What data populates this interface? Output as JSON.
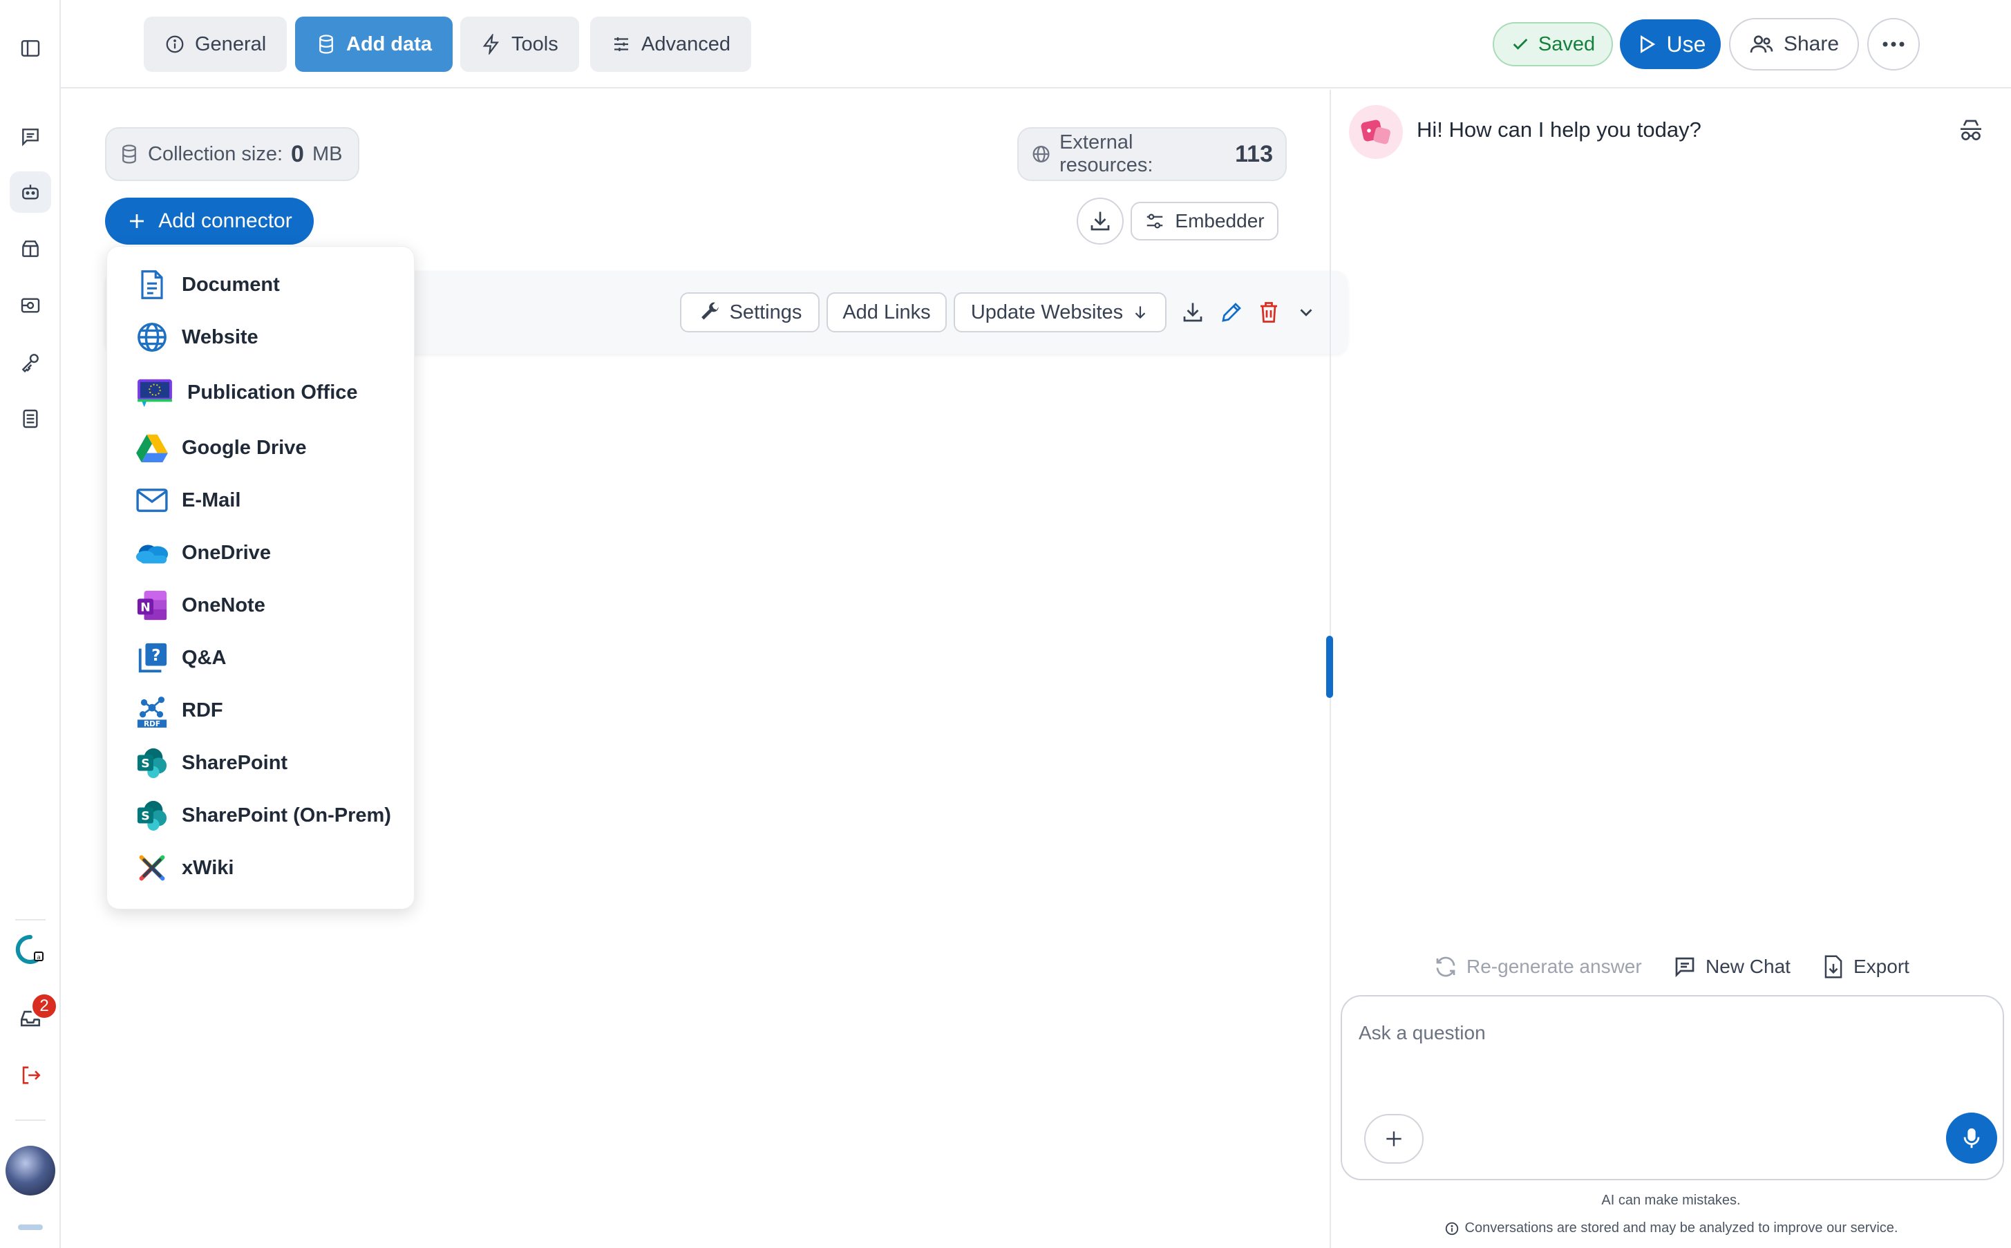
{
  "rail": {
    "notifications_count": "2"
  },
  "toolbar": {
    "tabs": [
      {
        "label": "General"
      },
      {
        "label": "Add data"
      },
      {
        "label": "Tools"
      },
      {
        "label": "Advanced"
      }
    ],
    "saved_label": "Saved",
    "use_label": "Use",
    "share_label": "Share"
  },
  "main": {
    "collection_size_label": "Collection size:",
    "collection_size_value": "0",
    "collection_size_unit": "MB",
    "external_resources_label": "External resources:",
    "external_resources_value": "113",
    "add_connector_label": "Add connector",
    "embedder_label": "Embedder",
    "card": {
      "settings_label": "Settings",
      "add_links_label": "Add Links",
      "update_websites_label": "Update Websites"
    }
  },
  "connector_menu": {
    "items": [
      {
        "label": "Document",
        "icon": "document-icon"
      },
      {
        "label": "Website",
        "icon": "globe-icon"
      },
      {
        "label": "Publication Office",
        "icon": "eu-publication-icon"
      },
      {
        "label": "Google Drive",
        "icon": "google-drive-icon"
      },
      {
        "label": "E-Mail",
        "icon": "mail-icon"
      },
      {
        "label": "OneDrive",
        "icon": "onedrive-icon"
      },
      {
        "label": "OneNote",
        "icon": "onenote-icon"
      },
      {
        "label": "Q&A",
        "icon": "qa-icon"
      },
      {
        "label": "RDF",
        "icon": "rdf-icon"
      },
      {
        "label": "SharePoint",
        "icon": "sharepoint-icon"
      },
      {
        "label": "SharePoint (On-Prem)",
        "icon": "sharepoint-icon"
      },
      {
        "label": "xWiki",
        "icon": "xwiki-icon"
      }
    ]
  },
  "chat": {
    "greeting": "Hi! How can I help you today?",
    "regenerate_label": "Re-generate answer",
    "new_chat_label": "New Chat",
    "export_label": "Export",
    "input_placeholder": "Ask a question",
    "disclaimer_1": "AI can make mistakes.",
    "disclaimer_2": "Conversations are stored and may be analyzed to improve our service."
  },
  "colors": {
    "primary": "#0f6cc9",
    "active_tab": "#3f8fd5",
    "saved_green": "#15803d",
    "danger": "#d92d20"
  }
}
